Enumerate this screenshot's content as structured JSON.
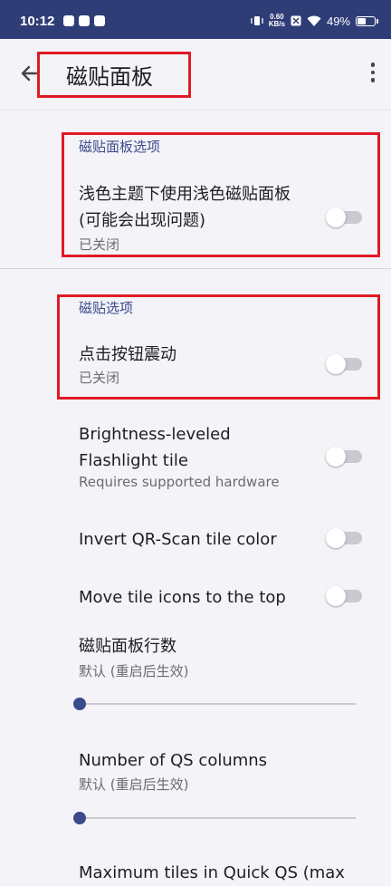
{
  "status_bar": {
    "time": "10:12",
    "net_speed_value": "0.60",
    "net_speed_unit": "KB/s",
    "battery": "49%"
  },
  "app_bar": {
    "title": "磁贴面板"
  },
  "sections": {
    "panel": {
      "header": "磁贴面板选项",
      "light_tiles": {
        "title": "浅色主题下使用浅色磁贴面板(可能会出现问题)",
        "summary": "已关闭"
      }
    },
    "tiles": {
      "header": "磁贴选项",
      "vibrate": {
        "title": "点击按钮震动",
        "summary": "已关闭"
      },
      "flashlight": {
        "title": "Brightness-leveled Flashlight tile",
        "summary": "Requires supported hardware"
      },
      "invert_qr": {
        "title": "Invert QR-Scan tile color"
      },
      "move_icons": {
        "title": "Move tile icons to the top"
      },
      "rows": {
        "title": "磁贴面板行数",
        "summary": "默认 (重启后生效)",
        "value": 0
      },
      "columns": {
        "title": "Number of QS columns",
        "summary": "默认 (重启后生效)",
        "value": 0
      },
      "max_tiles": {
        "title": "Maximum tiles in Quick QS (max"
      }
    }
  },
  "colors": {
    "status_bar": "#2f3d77",
    "accent": "#3c4a8c",
    "highlight": "#e01b24"
  }
}
